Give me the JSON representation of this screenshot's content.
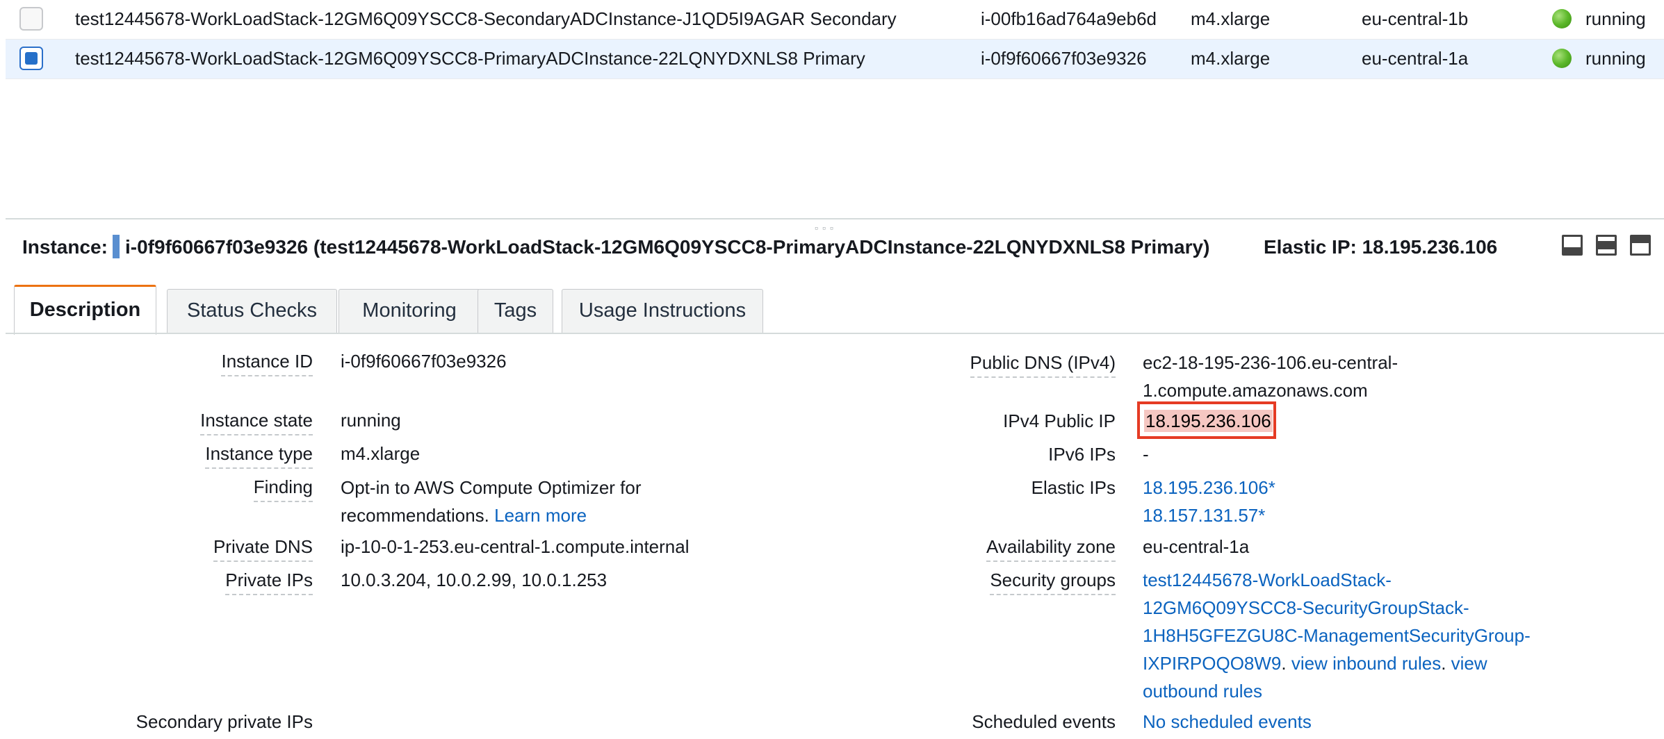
{
  "instances": [
    {
      "name": "test12445678-WorkLoadStack-12GM6Q09YSCC8-SecondaryADCInstance-J1QD5I9AGAR Secondary",
      "id": "i-00fb16ad764a9eb6d",
      "type": "m4.xlarge",
      "az": "eu-central-1b",
      "state": "running",
      "selected": false
    },
    {
      "name": "test12445678-WorkLoadStack-12GM6Q09YSCC8-PrimaryADCInstance-22LQNYDXNLS8 Primary",
      "id": "i-0f9f60667f03e9326",
      "type": "m4.xlarge",
      "az": "eu-central-1a",
      "state": "running",
      "selected": true
    }
  ],
  "detail_header": {
    "label": "Instance:",
    "value": "i-0f9f60667f03e9326 (test12445678-WorkLoadStack-12GM6Q09YSCC8-PrimaryADCInstance-22LQNYDXNLS8 Primary)",
    "elastic": "Elastic IP: 18.195.236.106"
  },
  "tabs": [
    "Description",
    "Status Checks",
    "Monitoring",
    "Tags",
    "Usage Instructions"
  ],
  "left_fields": {
    "instance_id": {
      "label": "Instance ID",
      "value": "i-0f9f60667f03e9326"
    },
    "instance_state": {
      "label": "Instance state",
      "value": "running"
    },
    "instance_type": {
      "label": "Instance type",
      "value": "m4.xlarge"
    },
    "finding": {
      "label": "Finding",
      "line1": "Opt-in to AWS Compute Optimizer for",
      "line2": "recommendations.",
      "link": "Learn more"
    },
    "private_dns": {
      "label": "Private DNS",
      "value": "ip-10-0-1-253.eu-central-1.compute.internal"
    },
    "private_ips": {
      "label": "Private IPs",
      "value": "10.0.3.204, 10.0.2.99, 10.0.1.253"
    },
    "secondary_ips": {
      "label": "Secondary private IPs"
    }
  },
  "right_fields": {
    "public_dns": {
      "label": "Public DNS (IPv4)",
      "line1": "ec2-18-195-236-106.eu-central-",
      "line2": "1.compute.amazonaws.com"
    },
    "ipv4_public_ip": {
      "label": "IPv4 Public IP",
      "value": "18.195.236.106"
    },
    "ipv6_ips": {
      "label": "IPv6 IPs",
      "value": "-"
    },
    "elastic_ips": {
      "label": "Elastic IPs",
      "values": [
        "18.195.236.106*",
        "18.157.131.57*"
      ]
    },
    "availability_zone": {
      "label": "Availability zone",
      "value": "eu-central-1a"
    },
    "security_groups": {
      "label": "Security groups",
      "line1": "test12445678-WorkLoadStack-",
      "line2": "12GM6Q09YSCC8-SecurityGroupStack-",
      "line3": "1H8H5GFEZGU8C-ManagementSecurityGroup-",
      "line4": "IXPIRPOQO8W9",
      "inbound": "view inbound rules",
      "outbound_a": "view",
      "outbound_b": "outbound rules"
    },
    "scheduled_events": {
      "label": "Scheduled events",
      "value": "No scheduled events"
    }
  },
  "colors": {
    "accent_tab": "#ec7211",
    "link": "#0b63bf",
    "highlight_border": "#e53b24",
    "running": "#5cb82a"
  }
}
